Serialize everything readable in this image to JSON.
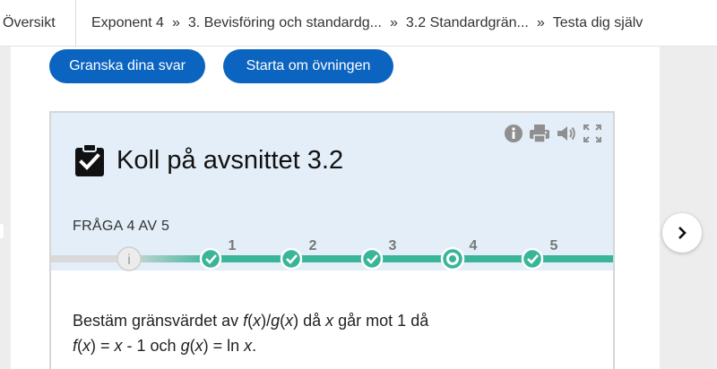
{
  "topbar": {
    "overview_label": "Översikt",
    "separator": "»",
    "breadcrumbs": [
      "Exponent 4",
      "3. Bevisföring och standardg...",
      "3.2 Standardgrän...",
      "Testa dig själv"
    ]
  },
  "buttons": {
    "review_label": "Granska dina svar",
    "restart_label": "Starta om övningen"
  },
  "card": {
    "title": "Koll på avsnittet 3.2",
    "question_count": "FRÅGA 4 AV 5",
    "progress": {
      "intro_marker": "i",
      "steps": [
        {
          "label": "1",
          "state": "done"
        },
        {
          "label": "2",
          "state": "done"
        },
        {
          "label": "3",
          "state": "done"
        },
        {
          "label": "4",
          "state": "current"
        },
        {
          "label": "5",
          "state": "done"
        }
      ]
    },
    "question": {
      "line1": [
        {
          "t": "Bestäm gränsvärdet av ",
          "i": false
        },
        {
          "t": "f",
          "i": true
        },
        {
          "t": "(",
          "i": false
        },
        {
          "t": "x",
          "i": true
        },
        {
          "t": ")/",
          "i": false
        },
        {
          "t": "g",
          "i": true
        },
        {
          "t": "(",
          "i": false
        },
        {
          "t": "x",
          "i": true
        },
        {
          "t": ") då ",
          "i": false
        },
        {
          "t": "x",
          "i": true
        },
        {
          "t": " går mot 1 då",
          "i": false
        }
      ],
      "line2": [
        {
          "t": "f",
          "i": true
        },
        {
          "t": "(",
          "i": false
        },
        {
          "t": "x",
          "i": true
        },
        {
          "t": ") = ",
          "i": false
        },
        {
          "t": "x",
          "i": true
        },
        {
          "t": " - 1 och ",
          "i": false
        },
        {
          "t": "g",
          "i": true
        },
        {
          "t": "(",
          "i": false
        },
        {
          "t": "x",
          "i": true
        },
        {
          "t": ") = ln ",
          "i": false
        },
        {
          "t": "x",
          "i": true
        },
        {
          "t": ".",
          "i": false
        }
      ]
    }
  },
  "icons": {
    "header": [
      "info-icon",
      "print-icon",
      "speaker-icon",
      "fullscreen-icon"
    ],
    "title": "clipboard-check-icon",
    "next": "chevron-right-icon"
  },
  "colors": {
    "button_blue": "#0b64c0",
    "card_header_bg": "#e3eef8",
    "progress_teal": "#3bb59a",
    "progress_track": "#d9d9d9",
    "icon_gray": "#8f8f8f"
  }
}
